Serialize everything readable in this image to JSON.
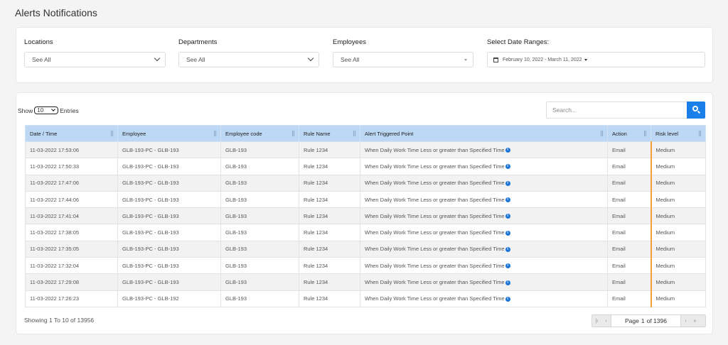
{
  "page": {
    "title": "Alerts Notifications"
  },
  "filters": {
    "locations": {
      "label": "Locations",
      "value": "See All"
    },
    "departments": {
      "label": "Departments",
      "value": "See All"
    },
    "employees": {
      "label": "Employees",
      "value": "See All"
    },
    "date_range": {
      "label": "Select Date Ranges:",
      "value": "February 10, 2022 - March 11, 2022"
    }
  },
  "table_controls": {
    "show_label": "Show",
    "entries_value": "10",
    "entries_label": "Entries",
    "search_placeholder": "Search..."
  },
  "table": {
    "columns": [
      "Date / Time",
      "Employee",
      "Employee code",
      "Rule Name",
      "Alert Triggered Point",
      "Action",
      "Risk level"
    ],
    "rows": [
      [
        "11-03-2022 17:53:06",
        "GLB-193-PC - GLB-193",
        "GLB-193",
        "Rule 1234",
        "When Daily Work Time Less or greater than Specified Time",
        "Email",
        "Medium"
      ],
      [
        "11-03-2022 17:50:33",
        "GLB-193-PC - GLB-193",
        "GLB-193",
        "Rule 1234",
        "When Daily Work Time Less or greater than Specified Time",
        "Email",
        "Medium"
      ],
      [
        "11-03-2022 17:47:06",
        "GLB-193-PC - GLB-193",
        "GLB-193",
        "Rule 1234",
        "When Daily Work Time Less or greater than Specified Time",
        "Email",
        "Medium"
      ],
      [
        "11-03-2022 17:44:06",
        "GLB-193-PC - GLB-193",
        "GLB-193",
        "Rule 1234",
        "When Daily Work Time Less or greater than Specified Time",
        "Email",
        "Medium"
      ],
      [
        "11-03-2022 17:41:04",
        "GLB-193-PC - GLB-193",
        "GLB-193",
        "Rule 1234",
        "When Daily Work Time Less or greater than Specified Time",
        "Email",
        "Medium"
      ],
      [
        "11-03-2022 17:38:05",
        "GLB-193-PC - GLB-193",
        "GLB-193",
        "Rule 1234",
        "When Daily Work Time Less or greater than Specified Time",
        "Email",
        "Medium"
      ],
      [
        "11-03-2022 17:35:05",
        "GLB-193-PC - GLB-193",
        "GLB-193",
        "Rule 1234",
        "When Daily Work Time Less or greater than Specified Time",
        "Email",
        "Medium"
      ],
      [
        "11-03-2022 17:32:04",
        "GLB-193-PC - GLB-193",
        "GLB-193",
        "Rule 1234",
        "When Daily Work Time Less or greater than Specified Time",
        "Email",
        "Medium"
      ],
      [
        "11-03-2022 17:29:08",
        "GLB-193-PC - GLB-193",
        "GLB-193",
        "Rule 1234",
        "When Daily Work Time Less or greater than Specified Time",
        "Email",
        "Medium"
      ],
      [
        "11-03-2022 17:26:23",
        "GLB-193-PC - GLB-192",
        "GLB-193",
        "Rule 1234",
        "When Daily Work Time Less or greater than Specified Time",
        "Email",
        "Medium"
      ]
    ]
  },
  "footer": {
    "showing": "Showing 1 To 10 of 13956",
    "page_label": "Page",
    "page_value": "1",
    "of_label": "of 1396"
  },
  "colors": {
    "accent": "#1a7fe8",
    "header_bg": "#bcd8f5",
    "risk_marker": "#f2a13a"
  },
  "icons": {
    "dropdown": "chevron-down-icon",
    "calendar": "calendar-icon",
    "search": "search-icon",
    "info": "info-icon",
    "sort": "sort-icon",
    "pager_first": "first-page-icon",
    "pager_prev": "prev-page-icon",
    "pager_next": "next-page-icon",
    "pager_last": "last-page-icon"
  }
}
